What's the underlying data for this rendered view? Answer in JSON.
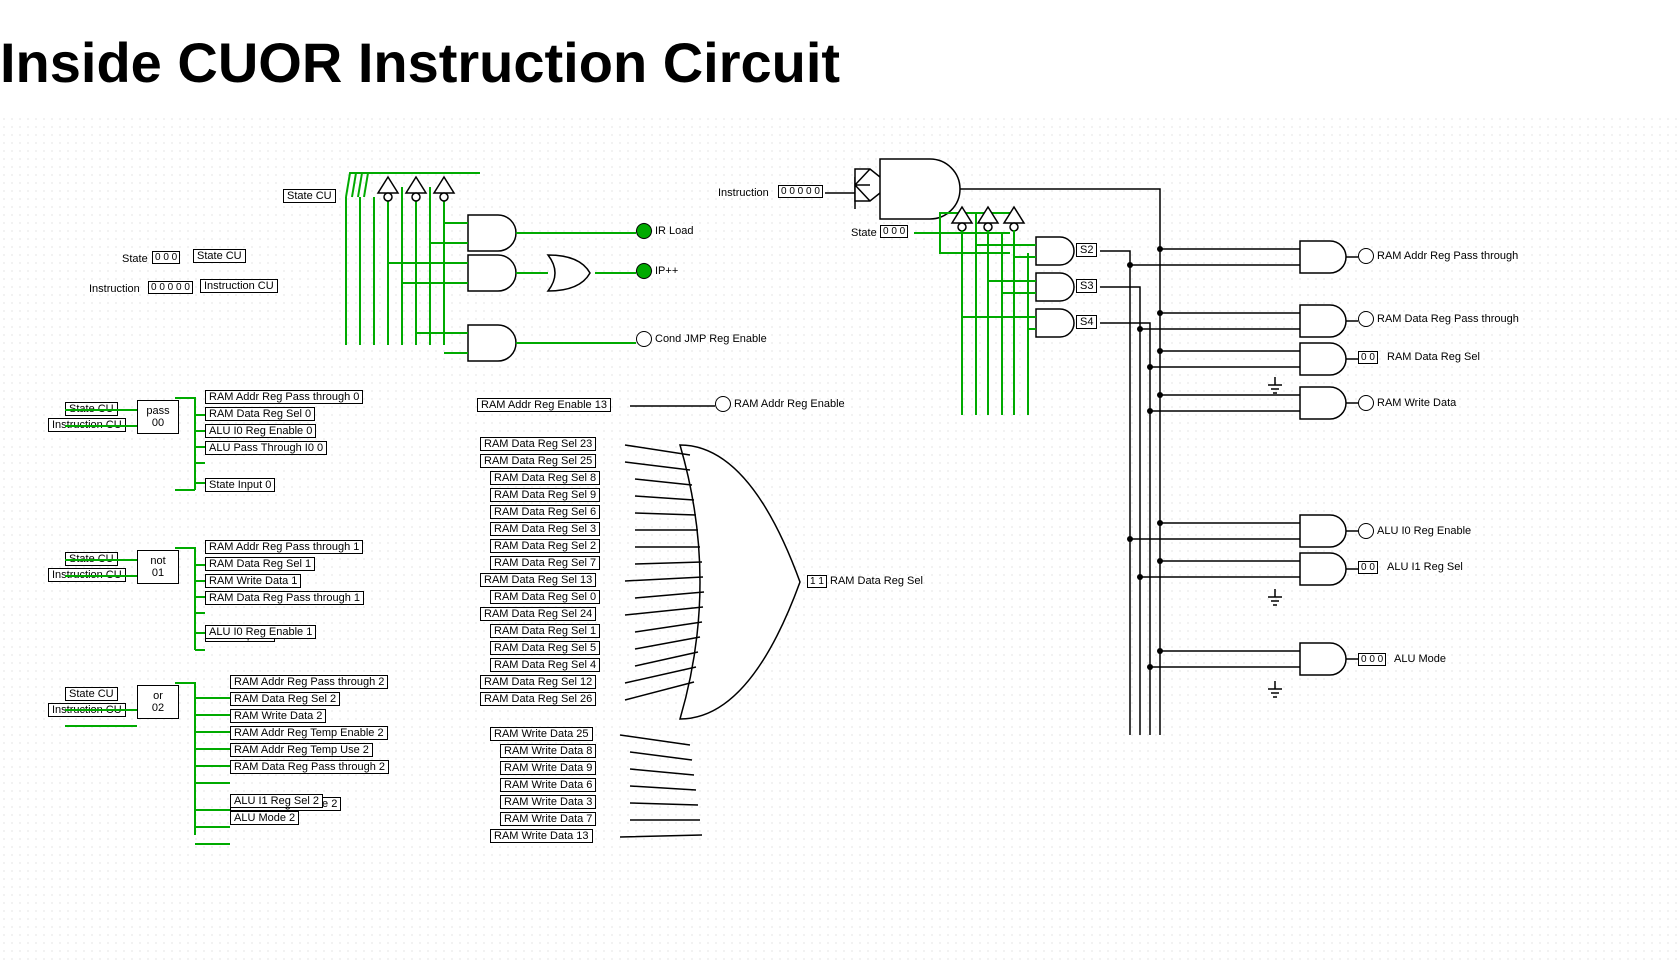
{
  "titles": {
    "left": "Inside CU",
    "right": "OR Instruction Circuit"
  },
  "left_inputs": {
    "state_label": "State",
    "state_val": "0 0 0",
    "state_cu": "State CU",
    "instruction_label": "Instruction",
    "instruction_val": "0 0 0 0 0",
    "instruction_cu": "Instruction CU"
  },
  "cu_signals": {
    "state_cu": "State CU",
    "ir_load": "IR Load",
    "ip_inc": "IP++",
    "cond_jmp": "Cond JMP Reg Enable",
    "ram_addr_en13": "RAM Addr Reg Enable 13",
    "ram_addr_en": "RAM Addr Reg Enable"
  },
  "blocks": [
    {
      "state": "State CU",
      "instr": "Instruction CU",
      "name": "pass",
      "code": "00",
      "outs": [
        "RAM Addr Reg Pass through 0",
        "RAM Data Reg Sel 0",
        "ALU I0 Reg Enable 0",
        "ALU Pass Through I0 0",
        "State Input 0"
      ]
    },
    {
      "state": "State CU",
      "instr": "Instruction CU",
      "name": "not",
      "code": "01",
      "outs": [
        "RAM Addr Reg Pass through 1",
        "RAM Data Reg Sel 1",
        "RAM Write Data 1",
        "RAM Data Reg Pass through 1",
        "State Input 1",
        "ALU I0 Reg Enable 1"
      ]
    },
    {
      "state": "State CU",
      "instr": "Instruction CU",
      "name": "or",
      "code": "02",
      "outs": [
        "RAM Addr Reg Pass through 2",
        "RAM Data Reg Sel 2",
        "RAM Write Data 2",
        "RAM Addr Reg Temp Enable 2",
        "RAM Addr Reg Temp Use 2",
        "RAM Data Reg Pass through 2",
        "ALU I0 Reg Enable 2",
        "ALU I1 Reg Sel 2",
        "ALU Mode 2"
      ]
    }
  ],
  "mux_sel": {
    "items": [
      "RAM Data Reg Sel 23",
      "RAM Data Reg Sel 25",
      "RAM Data Reg Sel 8",
      "RAM Data Reg Sel 9",
      "RAM Data Reg Sel 6",
      "RAM Data Reg Sel 3",
      "RAM Data Reg Sel 2",
      "RAM Data Reg Sel 7",
      "RAM Data Reg Sel 13",
      "RAM Data Reg Sel 0",
      "RAM Data Reg Sel 24",
      "RAM Data Reg Sel 1",
      "RAM Data Reg Sel 5",
      "RAM Data Reg Sel 4",
      "RAM Data Reg Sel 12",
      "RAM Data Reg Sel 26"
    ],
    "out_val": "1 1",
    "out": "RAM Data Reg Sel"
  },
  "mux_write": {
    "items": [
      "RAM Write Data 25",
      "RAM Write Data 8",
      "RAM Write Data 9",
      "RAM Write Data 6",
      "RAM Write Data 3",
      "RAM Write Data 7",
      "RAM Write Data 13"
    ]
  },
  "right": {
    "instruction_label": "Instruction",
    "instruction_val": "0 0 0 0 0",
    "state_label": "State",
    "state_val": "0 0 0",
    "s2": "S2",
    "s3": "S3",
    "s4": "S4",
    "outs": {
      "addr_pass": "RAM Addr Reg Pass through",
      "data_pass": "RAM Data Reg Pass through",
      "data_sel": "RAM Data Reg Sel",
      "data_sel_val": "0 0",
      "write": "RAM Write Data",
      "alu_i0": "ALU I0 Reg Enable",
      "alu_i1": "ALU I1 Reg Sel",
      "alu_i1_val": "0 0",
      "alu_mode": "ALU Mode",
      "alu_mode_val": "0 0 0"
    }
  }
}
